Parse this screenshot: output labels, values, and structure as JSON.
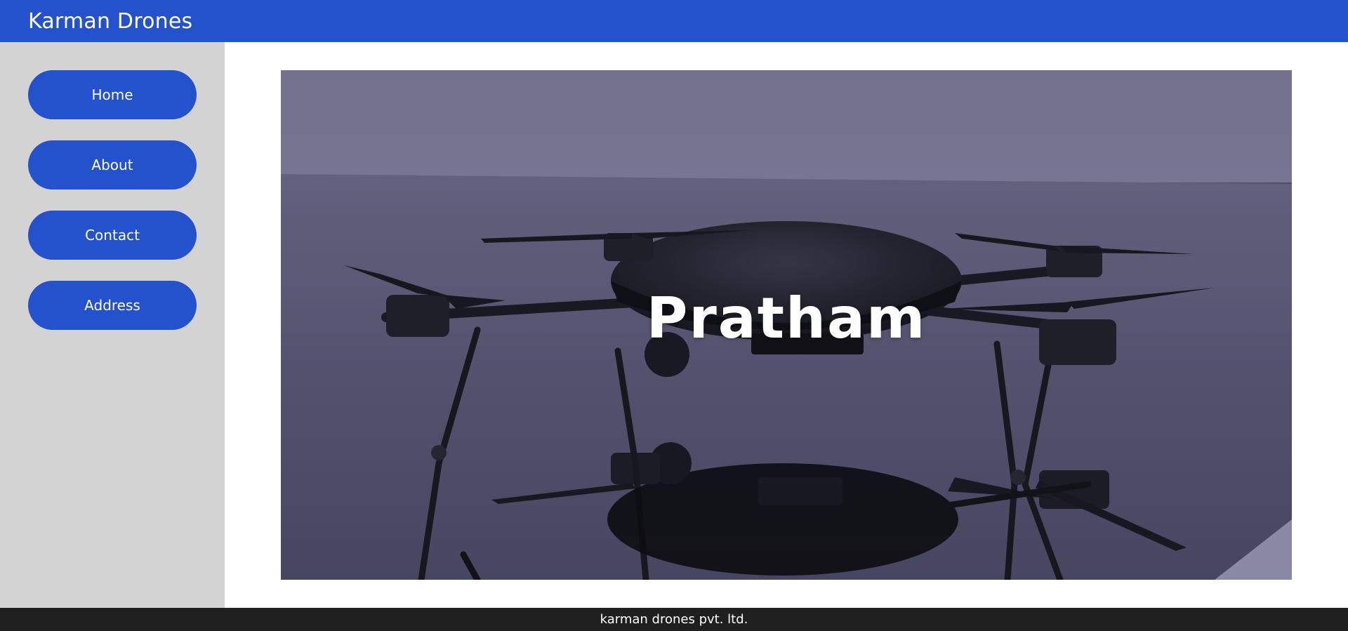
{
  "header": {
    "brand": "Karman Drones",
    "background_color": "#2451cc"
  },
  "sidebar": {
    "background_color": "#d3d3d3",
    "items": [
      {
        "label": "Home"
      },
      {
        "label": "About"
      },
      {
        "label": "Contact"
      },
      {
        "label": "Address"
      }
    ]
  },
  "hero": {
    "title": "Pratham",
    "image_subject": "drone"
  },
  "footer": {
    "text": "karman drones pvt. ltd.",
    "background_color": "#1f1f1f"
  }
}
